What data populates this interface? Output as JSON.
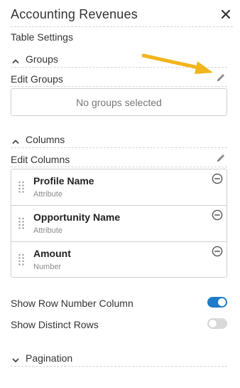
{
  "panel": {
    "title": "Accounting Revenues",
    "subtitle": "Table Settings"
  },
  "icons": {
    "close": "close-icon",
    "collapse": "chevron-up-icon",
    "expand": "chevron-down-icon",
    "edit": "pencil-icon",
    "drag": "drag-handle-icon",
    "remove": "minus-circle-icon",
    "annotation": "arrow-annotation"
  },
  "colors": {
    "accent": "#1f7ac8",
    "arrow": "#f1b51c"
  },
  "groups": {
    "header": "Groups",
    "edit_label": "Edit Groups",
    "empty_text": "No groups selected"
  },
  "columns": {
    "header": "Columns",
    "edit_label": "Edit Columns",
    "items": [
      {
        "name": "Profile Name",
        "type": "Attribute"
      },
      {
        "name": "Opportunity Name",
        "type": "Attribute"
      },
      {
        "name": "Amount",
        "type": "Number"
      }
    ]
  },
  "options": {
    "row_number": {
      "label": "Show Row Number Column",
      "enabled": true
    },
    "distinct": {
      "label": "Show Distinct Rows",
      "enabled": false
    }
  },
  "pagination": {
    "header": "Pagination"
  }
}
